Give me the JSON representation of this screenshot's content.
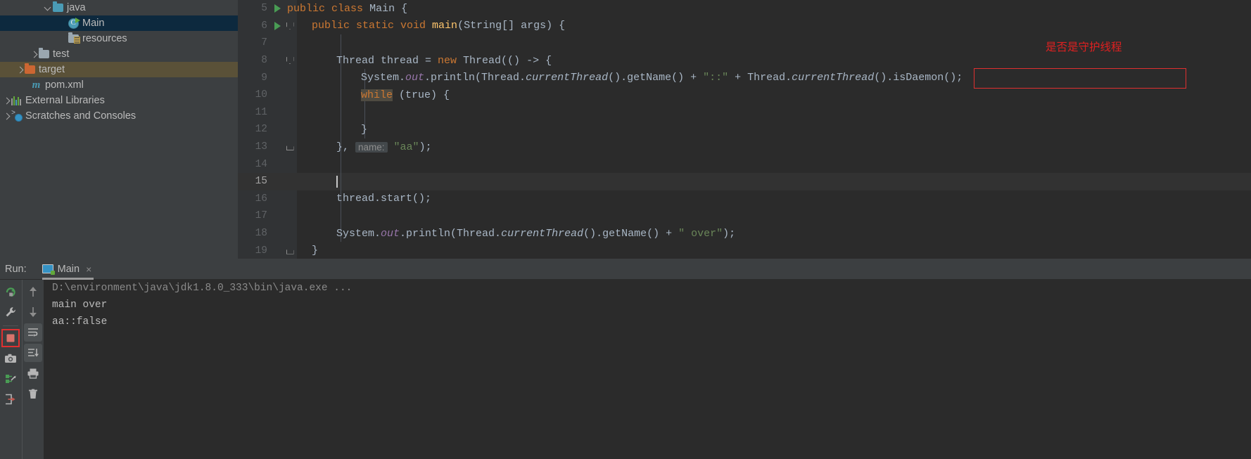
{
  "project_tree": {
    "items": [
      {
        "label": "java",
        "icon": "folder-source-icon",
        "indent": 62,
        "arrow": "open",
        "state": "normal"
      },
      {
        "label": "Main",
        "icon": "java-class-icon",
        "indent": 84,
        "arrow": "none",
        "state": "selected-focus"
      },
      {
        "label": "resources",
        "icon": "folder-resources-icon",
        "indent": 84,
        "arrow": "none",
        "state": "normal"
      },
      {
        "label": "test",
        "icon": "folder-icon",
        "indent": 40,
        "arrow": "closed",
        "state": "normal"
      },
      {
        "label": "target",
        "icon": "folder-target-icon",
        "indent": 20,
        "arrow": "closed",
        "state": "selected-target"
      },
      {
        "label": "pom.xml",
        "icon": "maven-icon",
        "indent": 42,
        "arrow": "none",
        "state": "normal"
      },
      {
        "label": "External Libraries",
        "icon": "external-libraries-icon",
        "indent": 0,
        "arrow": "closed",
        "state": "normal"
      },
      {
        "label": "Scratches and Consoles",
        "icon": "scratches-icon",
        "indent": 0,
        "arrow": "closed",
        "state": "normal"
      }
    ]
  },
  "editor": {
    "lines": [
      {
        "num": "5",
        "run": true,
        "fold": "none"
      },
      {
        "num": "6",
        "run": true,
        "fold": "start"
      },
      {
        "num": "7",
        "run": false,
        "fold": "none"
      },
      {
        "num": "8",
        "run": false,
        "fold": "start"
      },
      {
        "num": "9",
        "run": false,
        "fold": "none"
      },
      {
        "num": "10",
        "run": false,
        "fold": "none"
      },
      {
        "num": "11",
        "run": false,
        "fold": "none"
      },
      {
        "num": "12",
        "run": false,
        "fold": "none"
      },
      {
        "num": "13",
        "run": false,
        "fold": "end"
      },
      {
        "num": "14",
        "run": false,
        "fold": "none"
      },
      {
        "num": "15",
        "run": false,
        "fold": "none"
      },
      {
        "num": "16",
        "run": false,
        "fold": "none"
      },
      {
        "num": "17",
        "run": false,
        "fold": "none"
      },
      {
        "num": "18",
        "run": false,
        "fold": "none"
      },
      {
        "num": "19",
        "run": false,
        "fold": "end"
      }
    ],
    "code": {
      "l5_kw_public": "public",
      "l5_kw_class": "class",
      "l5_name": "Main",
      "l5_brace": "{",
      "l6_mods": "public static void",
      "l6_name": "main",
      "l6_args": "(String[] args) {",
      "l8_type": "Thread",
      "l8_var": " thread = ",
      "l8_new": "new",
      "l8_rest": " Thread(() -> {",
      "l9_a": "System.",
      "l9_out": "out",
      "l9_b": ".println(Thread.",
      "l9_ct": "currentThread",
      "l9_c": "().getName() + ",
      "l9_str": "\"::\"",
      "l9_d": " + ",
      "l9_boxed_a": "Thread.",
      "l9_boxed_ct": "currentThread",
      "l9_boxed_b": "().isDaemon()",
      "l9_tail": ";",
      "l10_while": "while",
      "l10_cond": " (true) {",
      "l12_close": "}",
      "l13_a": "}, ",
      "l13_hint": "name:",
      "l13_str": " \"aa\"",
      "l13_b": ");",
      "l16_text": "thread.start();",
      "l18_a": "System.",
      "l18_out": "out",
      "l18_b": ".println(Thread.",
      "l18_ct": "currentThread",
      "l18_c": "().getName() + ",
      "l18_str": "\" over\"",
      "l18_d": ");",
      "l19_close": "}"
    },
    "annotation": {
      "text": "是否是守护线程",
      "color": "#e02020",
      "box_color": "#e03030"
    }
  },
  "run_panel": {
    "run_label": "Run:",
    "tab_label": "Main",
    "tab_close": "×",
    "console": [
      {
        "text": "D:\\environment\\java\\jdk1.8.0_333\\bin\\java.exe ...",
        "kind": "cmd"
      },
      {
        "text": "main over",
        "kind": "out"
      },
      {
        "text": "aa::false",
        "kind": "out"
      }
    ],
    "toolbar_left": [
      {
        "name": "rerun-icon",
        "boxed": false
      },
      {
        "name": "settings-wrench-icon",
        "boxed": false
      },
      {
        "name": "stop-icon",
        "boxed": true
      },
      {
        "name": "camera-icon",
        "boxed": false
      },
      {
        "name": "thread-dump-icon",
        "boxed": false
      },
      {
        "name": "export-icon",
        "boxed": false
      }
    ],
    "toolbar_right": [
      {
        "name": "up-arrow-icon",
        "pressed": false
      },
      {
        "name": "down-arrow-icon",
        "pressed": false
      },
      {
        "name": "soft-wrap-icon",
        "pressed": true
      },
      {
        "name": "scroll-to-end-icon",
        "pressed": true
      },
      {
        "name": "print-icon",
        "pressed": false
      },
      {
        "name": "trash-icon",
        "pressed": false
      }
    ]
  },
  "colors": {
    "editor_bg": "#2b2b2b",
    "panel_bg": "#3c3f41",
    "gutter_bg": "#313335",
    "accent_red": "#e03030",
    "keyword_orange": "#cc7832",
    "string_green": "#6a8759",
    "method_yellow": "#ffc66d",
    "field_purple": "#9876aa",
    "text_gray": "#a9b7c6"
  }
}
